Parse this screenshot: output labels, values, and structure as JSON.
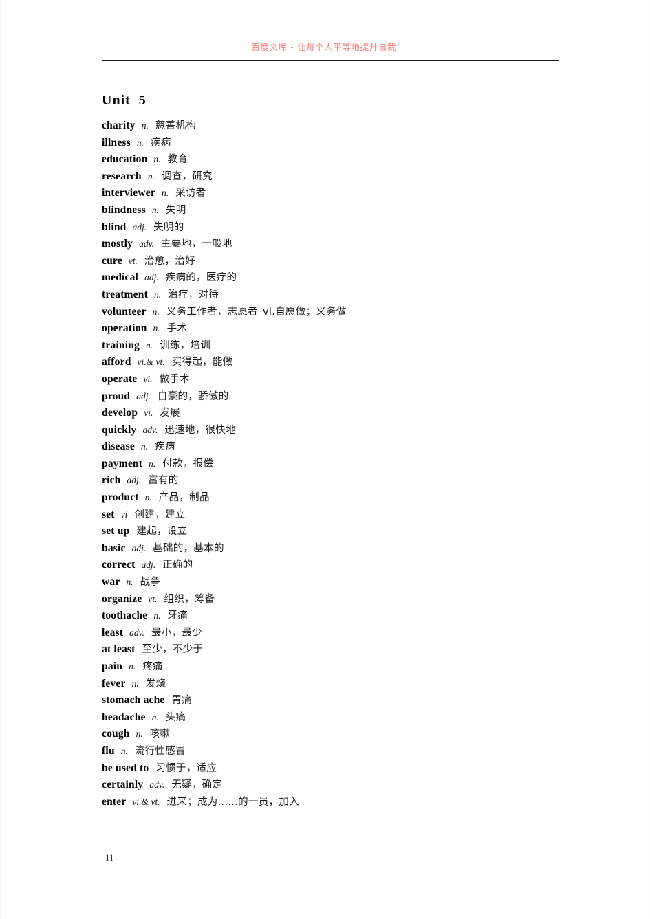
{
  "header": {
    "watermark": "百度文库 - 让每个人平等地提升自我!"
  },
  "document": {
    "unit_title": "Unit  5",
    "page_number": "11"
  },
  "vocabulary": [
    {
      "term": "charity",
      "pos": "n.",
      "definition": "慈善机构",
      "extra": ""
    },
    {
      "term": "illness",
      "pos": "n.",
      "definition": "疾病",
      "extra": ""
    },
    {
      "term": "education",
      "pos": "n.",
      "definition": "教育",
      "extra": ""
    },
    {
      "term": "research",
      "pos": "n.",
      "definition": "调查，研究",
      "extra": ""
    },
    {
      "term": "interviewer",
      "pos": "n.",
      "definition": "采访者",
      "extra": ""
    },
    {
      "term": "blindness",
      "pos": "n.",
      "definition": "失明",
      "extra": ""
    },
    {
      "term": "blind",
      "pos": "adj.",
      "definition": "失明的",
      "extra": ""
    },
    {
      "term": "mostly",
      "pos": "adv.",
      "definition": "主要地，一般地",
      "extra": ""
    },
    {
      "term": "cure",
      "pos": "vt.",
      "definition": "治愈，治好",
      "extra": ""
    },
    {
      "term": "medical",
      "pos": "adj.",
      "definition": "疾病的，医疗的",
      "extra": ""
    },
    {
      "term": "treatment",
      "pos": "n.",
      "definition": "治疗，对待",
      "extra": ""
    },
    {
      "term": "volunteer",
      "pos": "n.",
      "definition": "义务工作者，志愿者",
      "extra": "vi.自愿做；义务做"
    },
    {
      "term": "operation",
      "pos": "n.",
      "definition": "手术",
      "extra": ""
    },
    {
      "term": "training",
      "pos": "n.",
      "definition": "训练，培训",
      "extra": ""
    },
    {
      "term": "afford",
      "pos": "vi.& vt.",
      "definition": "买得起，能做",
      "extra": ""
    },
    {
      "term": "operate",
      "pos": "vi.",
      "definition": "做手术",
      "extra": ""
    },
    {
      "term": "proud",
      "pos": "adj.",
      "definition": "自豪的，骄傲的",
      "extra": ""
    },
    {
      "term": "develop",
      "pos": "vi.",
      "definition": "发展",
      "extra": ""
    },
    {
      "term": "quickly",
      "pos": "adv.",
      "definition": "迅速地，很快地",
      "extra": ""
    },
    {
      "term": "disease",
      "pos": "n.",
      "definition": "疾病",
      "extra": ""
    },
    {
      "term": "payment",
      "pos": "n.",
      "definition": "付款，报偿",
      "extra": ""
    },
    {
      "term": "rich",
      "pos": "adj.",
      "definition": "富有的",
      "extra": ""
    },
    {
      "term": "product",
      "pos": "n.",
      "definition": "产品，制品",
      "extra": ""
    },
    {
      "term": "set",
      "pos": "vi",
      "definition": "创建，建立",
      "extra": ""
    },
    {
      "term": "set up",
      "pos": "",
      "definition": "建起，设立",
      "extra": ""
    },
    {
      "term": "basic",
      "pos": "adj.",
      "definition": "基础的，基本的",
      "extra": ""
    },
    {
      "term": "correct",
      "pos": "adj.",
      "definition": "正确的",
      "extra": ""
    },
    {
      "term": "war",
      "pos": "n.",
      "definition": "战争",
      "extra": ""
    },
    {
      "term": "organize",
      "pos": "vt.",
      "definition": "组织，筹备",
      "extra": ""
    },
    {
      "term": "toothache",
      "pos": "n.",
      "definition": "牙痛",
      "extra": ""
    },
    {
      "term": "least",
      "pos": "adv.",
      "definition": "最小，最少",
      "extra": ""
    },
    {
      "term": "at least",
      "pos": "",
      "definition": "至少，不少于",
      "extra": ""
    },
    {
      "term": "pain",
      "pos": "n.",
      "definition": "疼痛",
      "extra": ""
    },
    {
      "term": "fever",
      "pos": "n.",
      "definition": "发烧",
      "extra": ""
    },
    {
      "term": "stomach ache",
      "pos": "",
      "definition": "胃痛",
      "extra": ""
    },
    {
      "term": "headache",
      "pos": "n.",
      "definition": "头痛",
      "extra": ""
    },
    {
      "term": "cough",
      "pos": "n.",
      "definition": "咳嗽",
      "extra": ""
    },
    {
      "term": "flu",
      "pos": "n.",
      "definition": "流行性感冒",
      "extra": ""
    },
    {
      "term": "be used to",
      "pos": "",
      "definition": "习惯于，适应",
      "extra": ""
    },
    {
      "term": "certainly",
      "pos": "adv.",
      "definition": "无疑，确定",
      "extra": ""
    },
    {
      "term": "enter",
      "pos": "vi.& vt.",
      "definition": "进来；成为……的一员，加入",
      "extra": ""
    }
  ]
}
